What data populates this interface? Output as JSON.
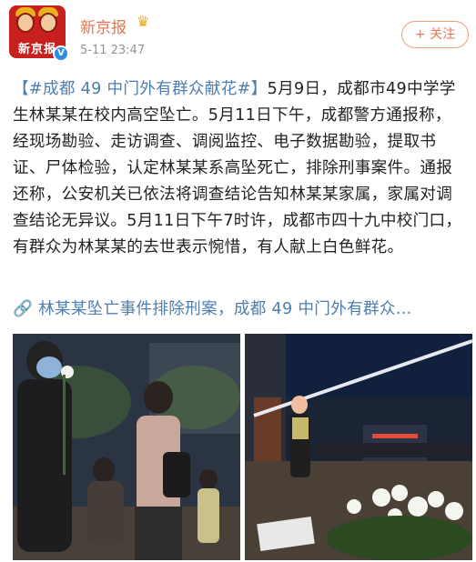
{
  "post": {
    "author": "新京报",
    "time": "5-11 23:47",
    "follow_label": "+ 关注",
    "hashtag": "#成都 49 中门外有群众献花#",
    "body": "5月9日，成都市49中学学生林某某在校内高空坠亡。5月11日下午，成都警方通报称，经现场勘验、走访调查、调阅监控、电子数据勘验，提取书证、尸体检验，认定林某某系高坠死亡，排除刑事案件。通报还称，公安机关已依法将调查结论告知林某某家属，家属对调查结论无异议。5月11日下午7时许，成都市四十九中校门口，有群众为林某某的去世表示惋惜，有人献上白色鲜花。",
    "link_text": "林某某坠亡事件排除刑案，成都 49 中门外有群众…"
  },
  "avatar": {
    "logo_text": "新京报"
  },
  "icons": {
    "verified": "verified-badge-icon",
    "crown": "crown-icon",
    "link": "link-icon"
  },
  "colors": {
    "accent": "#eb7350",
    "link": "#507daf",
    "timestamp": "#939393"
  }
}
